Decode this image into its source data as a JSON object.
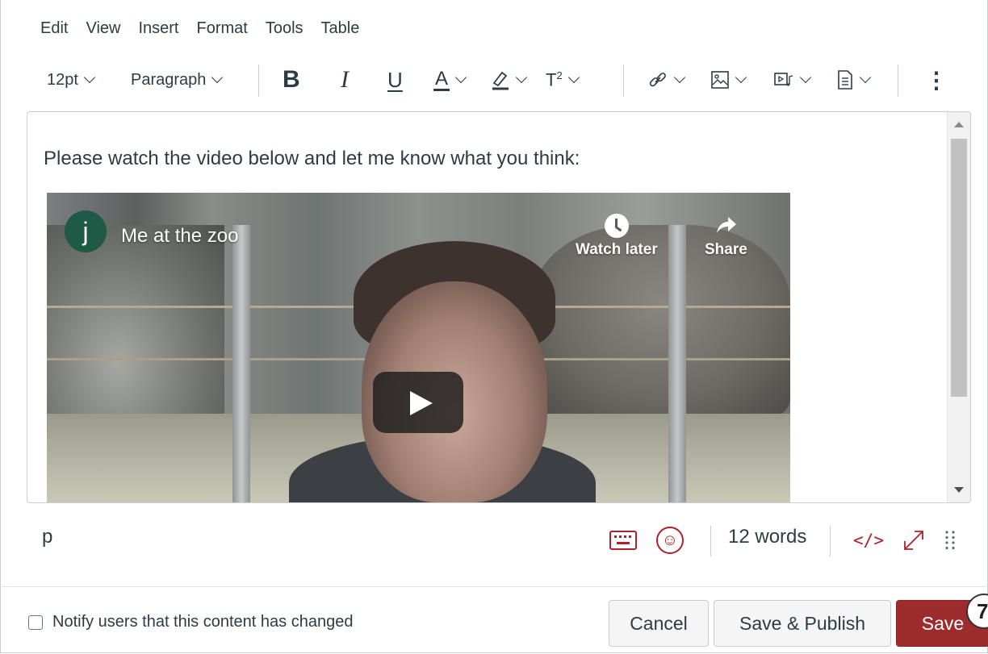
{
  "menubar": {
    "items": [
      "Edit",
      "View",
      "Insert",
      "Format",
      "Tools",
      "Table"
    ]
  },
  "toolbar": {
    "font_size": "12pt",
    "block_format": "Paragraph",
    "bold": "B",
    "italic": "I",
    "underline": "U",
    "text_color": "A",
    "superscript": "T",
    "superscript_mark": "2",
    "more": "⋮"
  },
  "editor": {
    "text": "Please watch the video below and let me know what you think:",
    "video": {
      "channel_initial": "j",
      "title": "Me at the zoo",
      "watch_later": "Watch later",
      "share": "Share"
    }
  },
  "statusbar": {
    "path": "p",
    "word_count": "12 words",
    "html_toggle": "</>"
  },
  "footer": {
    "notify_label": "Notify users that this content has changed",
    "notify_checked": false,
    "cancel_label": "Cancel",
    "save_publish_label": "Save & Publish",
    "save_label": "Save",
    "badge": "7"
  },
  "colors": {
    "accent": "#9e2c2f",
    "icon_red": "#b0202a",
    "text": "#2d3b45"
  }
}
